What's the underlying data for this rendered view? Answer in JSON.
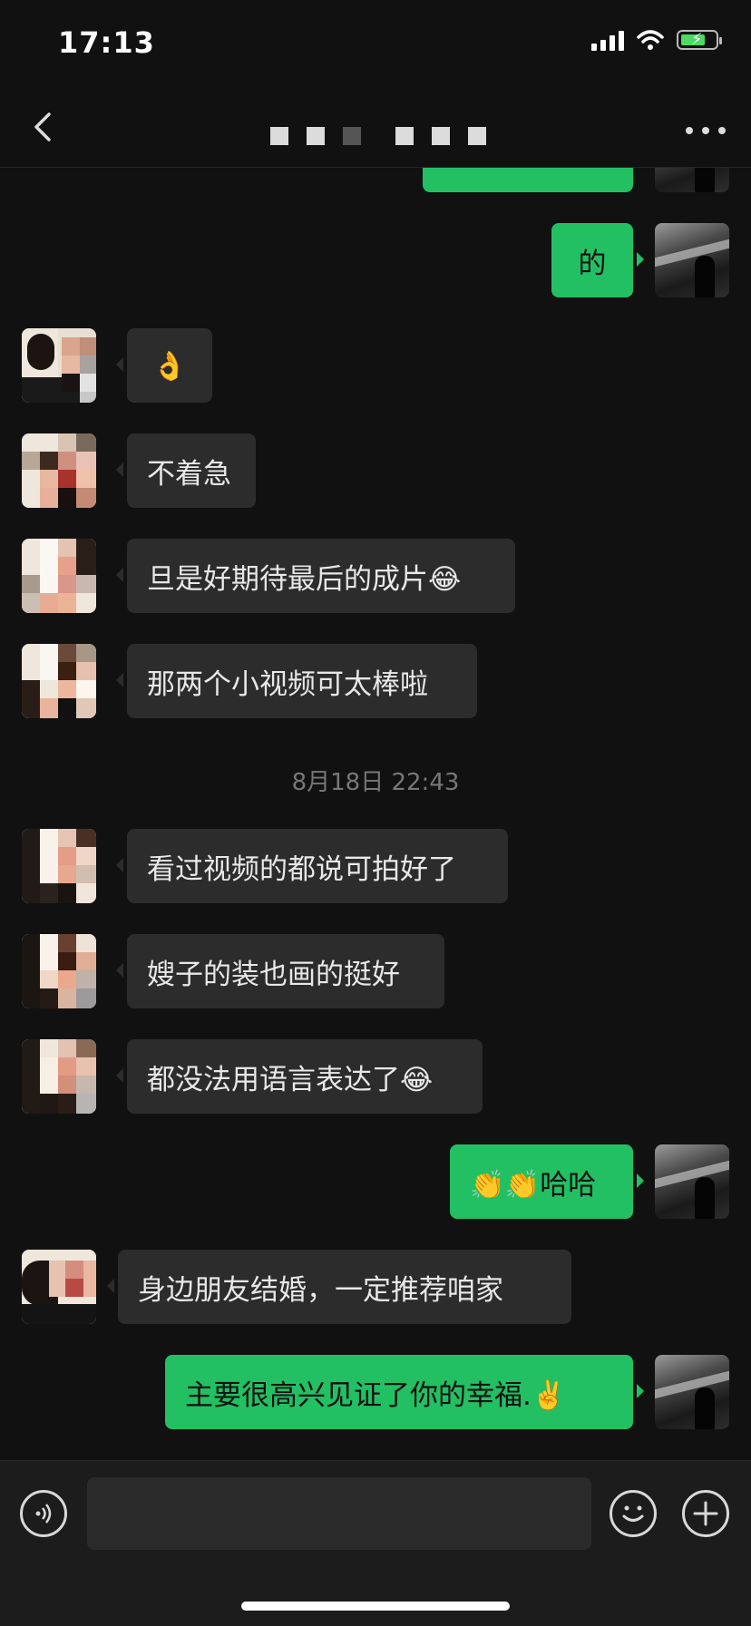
{
  "status_bar": {
    "time": "17:13",
    "battery_charging": true
  },
  "nav": {
    "back_icon": "chevron-left-icon",
    "more_icon": "more-dots-icon"
  },
  "messages": [
    {
      "side": "out",
      "text": ""
    },
    {
      "side": "out",
      "text": "的"
    },
    {
      "side": "in",
      "text": "👌"
    },
    {
      "side": "in",
      "text": "不着急"
    },
    {
      "side": "in",
      "text": "旦是好期待最后的成片😂"
    },
    {
      "side": "in",
      "text": "那两个小视频可太棒啦"
    },
    {
      "side": "in",
      "text": "看过视频的都说可拍好了"
    },
    {
      "side": "in",
      "text": "嫂子的装也画的挺好"
    },
    {
      "side": "in",
      "text": "都没法用语言表达了😂"
    },
    {
      "side": "out",
      "text": "👏👏哈哈"
    },
    {
      "side": "in",
      "text": "身边朋友结婚，一定推荐咱家"
    },
    {
      "side": "out",
      "text": "主要很高兴见证了你的幸福.✌️"
    }
  ],
  "timestamp": "8月18日 22:43",
  "input_bar": {
    "placeholder": "",
    "voice_icon": "voice-icon",
    "emoji_icon": "emoji-icon",
    "plus_icon": "plus-icon"
  },
  "colors": {
    "bubble_out": "#22c063",
    "bubble_in": "#2c2c2c",
    "background": "#111111"
  }
}
